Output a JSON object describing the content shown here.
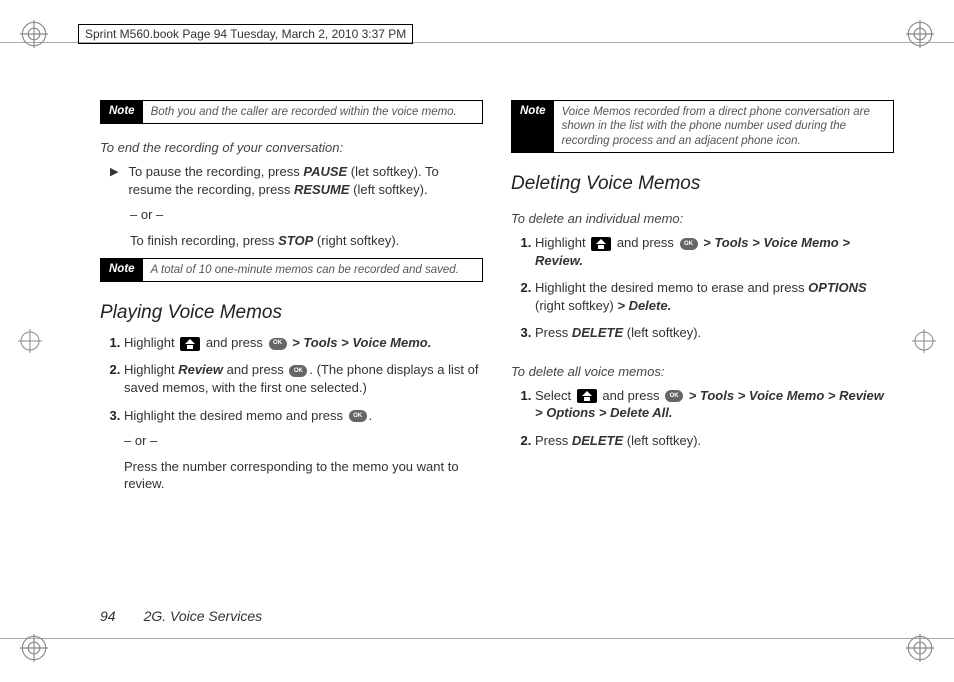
{
  "header_line": "Sprint M560.book  Page 94  Tuesday, March 2, 2010  3:37 PM",
  "left": {
    "note1": {
      "label": "Note",
      "text": "Both you and the caller are recorded within the voice memo."
    },
    "sub1": "To end the recording of your conversation:",
    "step1_a": "To pause the recording, press ",
    "pause": "PAUSE",
    "step1_b": " (let softkey). To resume the recording, press ",
    "resume": "RESUME",
    "step1_c": " (left softkey).",
    "or": "– or –",
    "finish_a": "To finish recording, press ",
    "stop": "STOP",
    "finish_b": " (right softkey).",
    "note2": {
      "label": "Note",
      "text": "A total of 10 one-minute memos can be recorded and saved."
    },
    "title": "Playing Voice Memos",
    "ol1_a": "Highlight ",
    "ol1_b": " and press ",
    "ol1_path": " > Tools > Voice Memo.",
    "ol2_a": "Highlight ",
    "review": "Review",
    "ol2_b": " and press ",
    "ol2_c": ". (The phone displays a list of saved memos, with the first one selected.)",
    "ol3_a": "Highlight the desired memo and press ",
    "ol3_b": ".",
    "sub_or": "– or –",
    "sub_press": "Press the number corresponding to the memo you want to review."
  },
  "right": {
    "note1": {
      "label": "Note",
      "text": "Voice Memos recorded from a direct phone conversation are shown in the list with the phone number used during the recording process and an adjacent phone icon."
    },
    "title": "Deleting Voice Memos",
    "sub1": "To delete an individual memo:",
    "ol1_a": "Highlight ",
    "ol1_b": " and press ",
    "ol1_path": " > Tools > Voice Memo > Review.",
    "ol2_a": "Highlight the desired memo to erase and press ",
    "options": "OPTIONS",
    "ol2_b": " (right softkey) ",
    "delete_path": "> Delete.",
    "ol3_a": "Press ",
    "delete": "DELETE",
    "ol3_b": " (left softkey).",
    "sub2": "To delete all voice memos:",
    "ol4_a": "Select ",
    "ol4_b": " and press ",
    "ol4_path": " > Tools > Voice Memo > Review > Options > Delete All.",
    "ol5_a": "Press ",
    "ol5_b": " (left softkey)."
  },
  "footer": {
    "page": "94",
    "section": "2G. Voice Services"
  },
  "ok_label": "OK"
}
